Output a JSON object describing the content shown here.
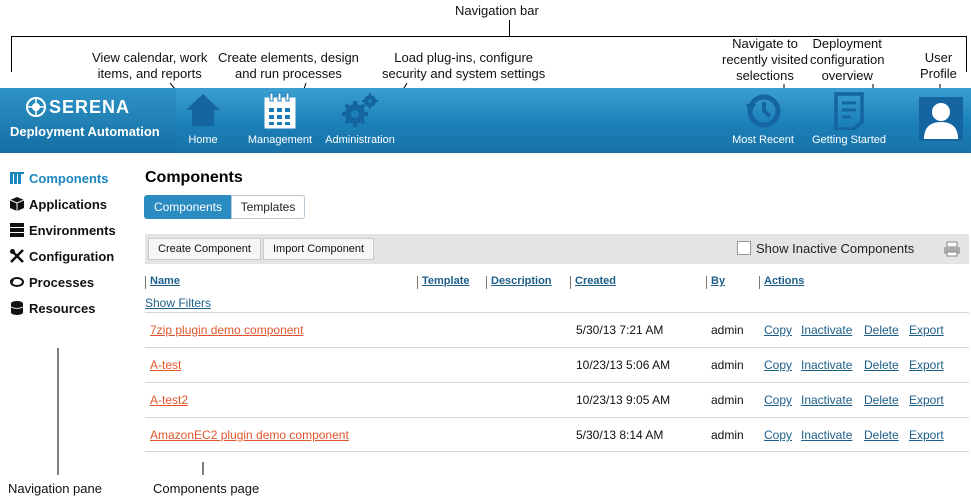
{
  "annotations": {
    "navigation_bar": "Navigation bar",
    "calendar_line1": "View calendar, work",
    "calendar_line2": "items, and reports",
    "management_line1": "Create elements, design",
    "management_line2": "and run processes",
    "admin_line1": "Load plug-ins, configure",
    "admin_line2": "security and system settings",
    "recent_line1": "Navigate to",
    "recent_line2": "recently visited",
    "recent_line3": "selections",
    "deploy_line1": "Deployment",
    "deploy_line2": "configuration",
    "deploy_line3": "overview",
    "user_line1": "User",
    "user_line2": "Profile",
    "navigation_pane": "Navigation pane",
    "components_page": "Components page"
  },
  "header": {
    "brand": "SERENA",
    "product": "Deployment Automation",
    "nav": {
      "home": "Home",
      "management": "Management",
      "administration": "Administration",
      "most_recent": "Most Recent",
      "getting_started": "Getting Started"
    }
  },
  "sidebar": {
    "items": [
      {
        "label": "Components",
        "icon": "components-icon"
      },
      {
        "label": "Applications",
        "icon": "cube-icon"
      },
      {
        "label": "Environments",
        "icon": "server-icon"
      },
      {
        "label": "Configuration",
        "icon": "tools-icon"
      },
      {
        "label": "Processes",
        "icon": "process-icon"
      },
      {
        "label": "Resources",
        "icon": "database-icon"
      }
    ]
  },
  "main": {
    "title": "Components",
    "tabs": [
      "Components",
      "Templates"
    ],
    "toolbar": {
      "create": "Create Component",
      "import": "Import Component",
      "show_inactive": "Show Inactive Components"
    },
    "columns": [
      "Name",
      "Template",
      "Description",
      "Created",
      "By",
      "Actions"
    ],
    "show_filters": "Show Filters",
    "actions": [
      "Copy",
      "Inactivate",
      "Delete",
      "Export"
    ],
    "rows": [
      {
        "name": "7zip plugin demo component",
        "created": "5/30/13 7:21 AM",
        "by": "admin"
      },
      {
        "name": "A-test",
        "created": "10/23/13 5:06 AM",
        "by": "admin"
      },
      {
        "name": "A-test2",
        "created": "10/23/13 9:05 AM",
        "by": "admin"
      },
      {
        "name": "AmazonEC2 plugin demo component",
        "created": "5/30/13 8:14 AM",
        "by": "admin"
      }
    ]
  },
  "colors": {
    "nav_blue": "#1b80b8",
    "active_blue": "#1a86bf",
    "link_orange": "#e0562b",
    "link_blue": "#1d5f8a"
  }
}
